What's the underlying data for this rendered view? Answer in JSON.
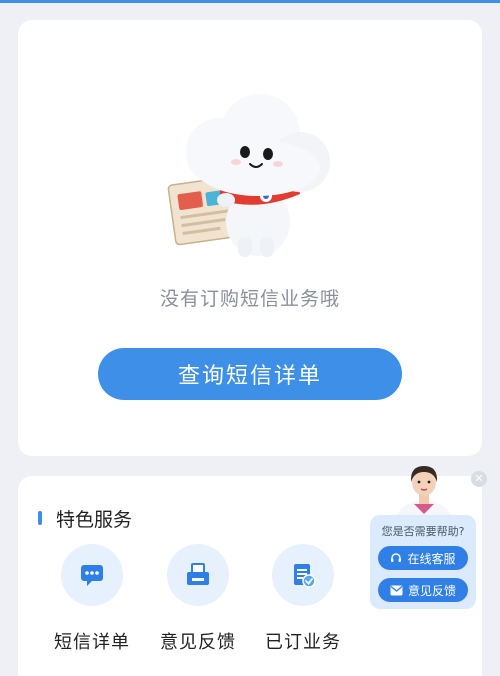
{
  "main": {
    "empty_text": "没有订购短信业务哦",
    "query_button": "查询短信详单"
  },
  "services": {
    "section_title": "特色服务",
    "items": [
      {
        "label": "短信详单",
        "icon": "sms-icon"
      },
      {
        "label": "意见反馈",
        "icon": "printer-icon"
      },
      {
        "label": "已订业务",
        "icon": "document-check-icon"
      }
    ]
  },
  "help": {
    "prompt": "您是否需要帮助?",
    "online_service": "在线客服",
    "feedback": "意见反馈"
  },
  "colors": {
    "accent": "#3d8fe8",
    "background": "#eef0f5",
    "icon_bg": "#e7f1fd"
  }
}
